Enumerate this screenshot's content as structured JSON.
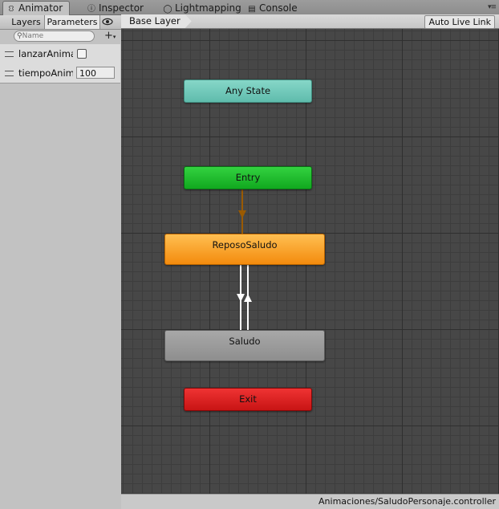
{
  "tabs": [
    {
      "label": "Animator",
      "icon": "animator-icon",
      "active": true
    },
    {
      "label": "Inspector",
      "icon": "info-icon",
      "active": false
    },
    {
      "label": "Lightmapping",
      "icon": "lightbulb-icon",
      "active": false
    },
    {
      "label": "Console",
      "icon": "console-icon",
      "active": false
    }
  ],
  "left_panel": {
    "subtabs": [
      {
        "label": "Layers",
        "active": false
      },
      {
        "label": "Parameters",
        "active": true
      }
    ],
    "search": {
      "placeholder": "Name"
    },
    "parameters": [
      {
        "name": "lanzarAnima",
        "type": "bool",
        "value": false
      },
      {
        "name": "tiempoAnim",
        "type": "int",
        "value": "100"
      }
    ]
  },
  "breadcrumb": {
    "layer": "Base Layer"
  },
  "toolbar": {
    "auto_live_link": "Auto Live Link"
  },
  "states": [
    {
      "name": "Any State",
      "kind": "any-state",
      "color": "#6cc7b8"
    },
    {
      "name": "Entry",
      "kind": "entry",
      "color": "#16b82a"
    },
    {
      "name": "ReposoSaludo",
      "kind": "default",
      "color": "#f39a1c"
    },
    {
      "name": "Saludo",
      "kind": "normal",
      "color": "#9a9a9a"
    },
    {
      "name": "Exit",
      "kind": "exit",
      "color": "#d41f1f"
    }
  ],
  "status": {
    "path": "Animaciones/SaludoPersonaje.controller"
  }
}
